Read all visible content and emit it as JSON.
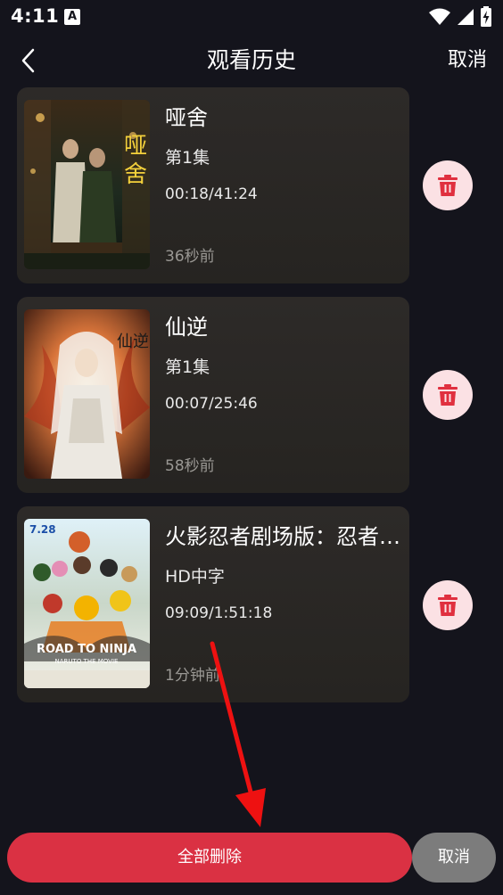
{
  "status_bar": {
    "time": "4:11",
    "app_icon_letter": "A",
    "icons": [
      "wifi-icon",
      "signal-icon",
      "battery-charging-icon"
    ]
  },
  "header": {
    "title": "观看历史",
    "cancel_label": "取消"
  },
  "history": [
    {
      "title": "哑舍",
      "episode": "第1集",
      "progress": "00:18/41:24",
      "watched_ago": "36秒前",
      "poster_icon": "poster-yashe"
    },
    {
      "title": "仙逆",
      "episode": "第1集",
      "progress": "00:07/25:46",
      "watched_ago": "58秒前",
      "poster_icon": "poster-xianni"
    },
    {
      "title": "火影忍者剧场版：忍者之路",
      "episode": "HD中字",
      "progress": "09:09/1:51:18",
      "watched_ago": "1分钟前",
      "poster_icon": "poster-naruto-road-to-ninja"
    }
  ],
  "posters": {
    "poster_2_text": "仙逆",
    "poster_3_date": "7.28",
    "poster_3_title": "ROAD TO NINJA",
    "poster_3_subtitle": "NARUTO THE MOVIE"
  },
  "bottom_bar": {
    "delete_all_label": "全部删除",
    "cancel_label": "取消"
  },
  "colors": {
    "background": "#14141c",
    "card": "#2a2825",
    "delete_accent": "#da3143",
    "delete_icon_bg": "#fbe1e4",
    "cancel_gray": "#7c7c7c"
  }
}
